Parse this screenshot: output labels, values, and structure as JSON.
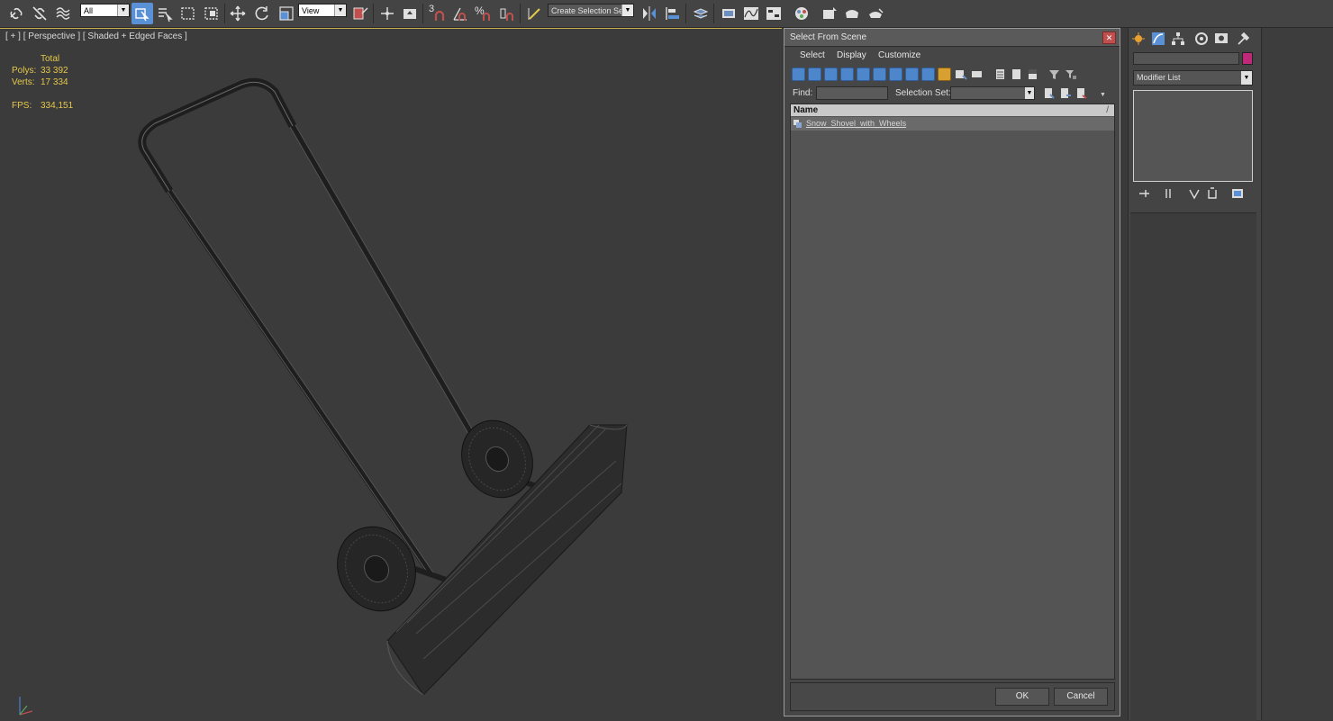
{
  "toolbar": {
    "filter_combo": "All",
    "refcoord_combo": "View",
    "selection_set_combo": "Create Selection Se",
    "snap_label": "3",
    "percent_label": "%",
    "icons": [
      "link-icon",
      "unlink-icon",
      "bind-spacewarp-icon",
      "select-object-icon",
      "select-by-name-icon",
      "rect-region-icon",
      "window-crossing-icon",
      "move-icon",
      "rotate-icon",
      "scale-icon",
      "pivot-icon",
      "select-manipulate-icon",
      "keyboard-shortcut-icon",
      "snap-icon",
      "angle-snap-icon",
      "percent-snap-icon",
      "spinner-snap-icon",
      "edit-named-sets-icon",
      "mirror-icon",
      "align-icon",
      "layer-manager-icon",
      "graphite-tools-icon",
      "curve-editor-icon",
      "schematic-view-icon",
      "material-editor-icon",
      "render-setup-icon",
      "rendered-frame-icon",
      "render-icon"
    ]
  },
  "viewport": {
    "label": "[ + ] [ Perspective ] [ Shaded + Edged Faces ]",
    "stats": {
      "total_label": "Total",
      "polys_label": "Polys:",
      "polys_value": "33 392",
      "verts_label": "Verts:",
      "verts_value": "17 334",
      "fps_label": "FPS:",
      "fps_value": "334,151"
    }
  },
  "dialog": {
    "title": "Select From Scene",
    "close_label": "✕",
    "menu": [
      "Select",
      "Display",
      "Customize"
    ],
    "find_label": "Find:",
    "find_value": "",
    "selection_set_label": "Selection Set:",
    "column_name": "Name",
    "sort_indicator": "/",
    "rows": [
      "Snow_Shovel_with_Wheels"
    ],
    "ok_label": "OK",
    "cancel_label": "Cancel"
  },
  "command_panel": {
    "modifier_list": "Modifier List",
    "swatch_color": "#c0287a",
    "tabs": [
      "create-icon",
      "modify-icon",
      "hierarchy-icon",
      "motion-icon",
      "display-icon",
      "utilities-icon"
    ]
  },
  "colors": {
    "accent_blue": "#5a90d6",
    "stat_yellow": "#e6c84a",
    "viewport_bg": "#3b3b3b",
    "active_border": "#c8b050"
  }
}
